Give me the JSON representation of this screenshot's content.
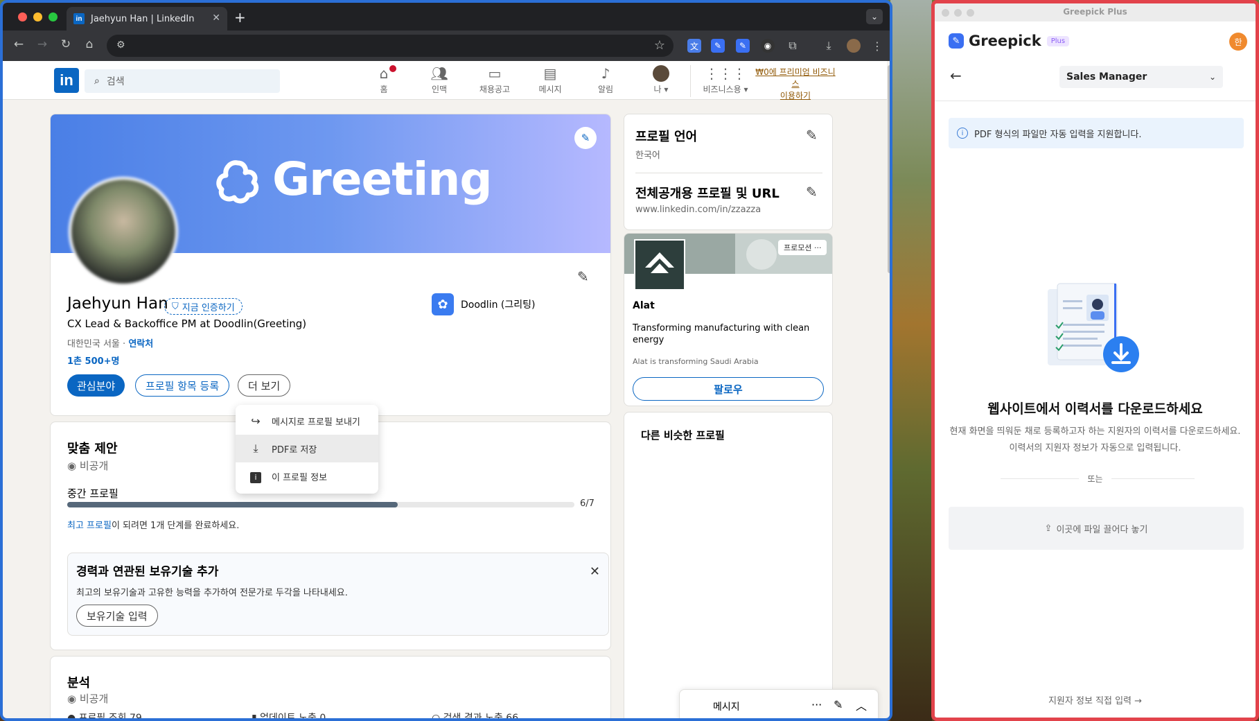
{
  "browser": {
    "tab_title": "Jaehyun Han | LinkedIn",
    "tab_favicon": "in",
    "new_tab": "+",
    "close": "✕"
  },
  "linkedin": {
    "logo": "in",
    "search_placeholder": "검색",
    "nav": [
      {
        "icon": "home-icon",
        "label": "홈"
      },
      {
        "icon": "network-icon",
        "label": "인맥"
      },
      {
        "icon": "jobs-icon",
        "label": "채용공고"
      },
      {
        "icon": "messaging-icon",
        "label": "메시지"
      },
      {
        "icon": "bell-icon",
        "label": "알림"
      },
      {
        "icon": "me-icon",
        "label": "나"
      }
    ],
    "business": "비즈니스용",
    "premium_line1": "₩0에 프리미엄 비즈니스",
    "premium_line2": "이용하기",
    "profile": {
      "banner_text": "Greeting",
      "name": "Jaehyun Han",
      "verify": "지금 인증하기",
      "headline": "CX Lead & Backoffice PM at Doodlin(Greeting)",
      "location": "대한민국 서울 ·",
      "contact": "연락처",
      "connections": "1촌 500+명",
      "company": "Doodlin (그리팅)",
      "btn_open": "관심분야",
      "btn_add": "프로필 항목 등록",
      "btn_more": "더 보기"
    },
    "dropdown": [
      {
        "icon": "share-icon",
        "label": "메시지로 프로필 보내기"
      },
      {
        "icon": "download-icon",
        "label": "PDF로 저장"
      },
      {
        "icon": "info-icon",
        "label": "이 프로필 정보"
      }
    ],
    "suggest": {
      "title": "맞춤 제안",
      "privacy": "비공개",
      "level": "중간 프로필",
      "progress_value": 6,
      "progress_max": 7,
      "progress_text": "6/7",
      "hint_link": "최고 프로필",
      "hint_text": "이 되려면 1개 단계를 완료하세요.",
      "skill_title": "경력과 연관된 보유기술 추가",
      "skill_text": "최고의 보유기술과 고유한 능력을 추가하여 전문가로 두각을 나타내세요.",
      "skill_btn": "보유기술 입력"
    },
    "analytics": {
      "title": "분석",
      "privacy": "비공개",
      "stats": [
        "프로필 조회 79",
        "업데이트 노출 0",
        "검색 결과 노출 66"
      ]
    },
    "right": {
      "lang_title": "프로필 언어",
      "lang_value": "한국어",
      "url_title": "전체공개용 프로필 및 URL",
      "url_value": "www.linkedin.com/in/zzazza",
      "promo_tag": "프로모션",
      "promo_more": "···",
      "promo_name": "Alat",
      "promo_desc": "Transforming manufacturing with clean energy",
      "promo_sub": "Alat is transforming Saudi Arabia",
      "follow": "팔로우",
      "similar": "다른 비슷한 프로필"
    },
    "messaging": "메시지"
  },
  "greepick": {
    "window_title": "Greepick Plus",
    "brand": "Greepick",
    "plus": "Plus",
    "avatar": "한",
    "job": "Sales Manager",
    "info": "PDF 형식의 파일만 자동 입력을 지원합니다.",
    "heading": "웹사이트에서 이력서를 다운로드하세요",
    "desc1": "현재 화면을 띄워둔 채로 등록하고자 하는 지원자의 이력서를 다운로드하세요.",
    "desc2": "이력서의 지원자 정보가 자동으로 입력됩니다.",
    "or": "또는",
    "drop": "이곳에 파일 끌어다 놓기",
    "direct": "지원자 정보 직접 입력 →"
  },
  "colors": {
    "linkedin_blue": "#0a66c2",
    "greepick_border": "#e2434b",
    "chrome_border": "#2b6fd6"
  }
}
